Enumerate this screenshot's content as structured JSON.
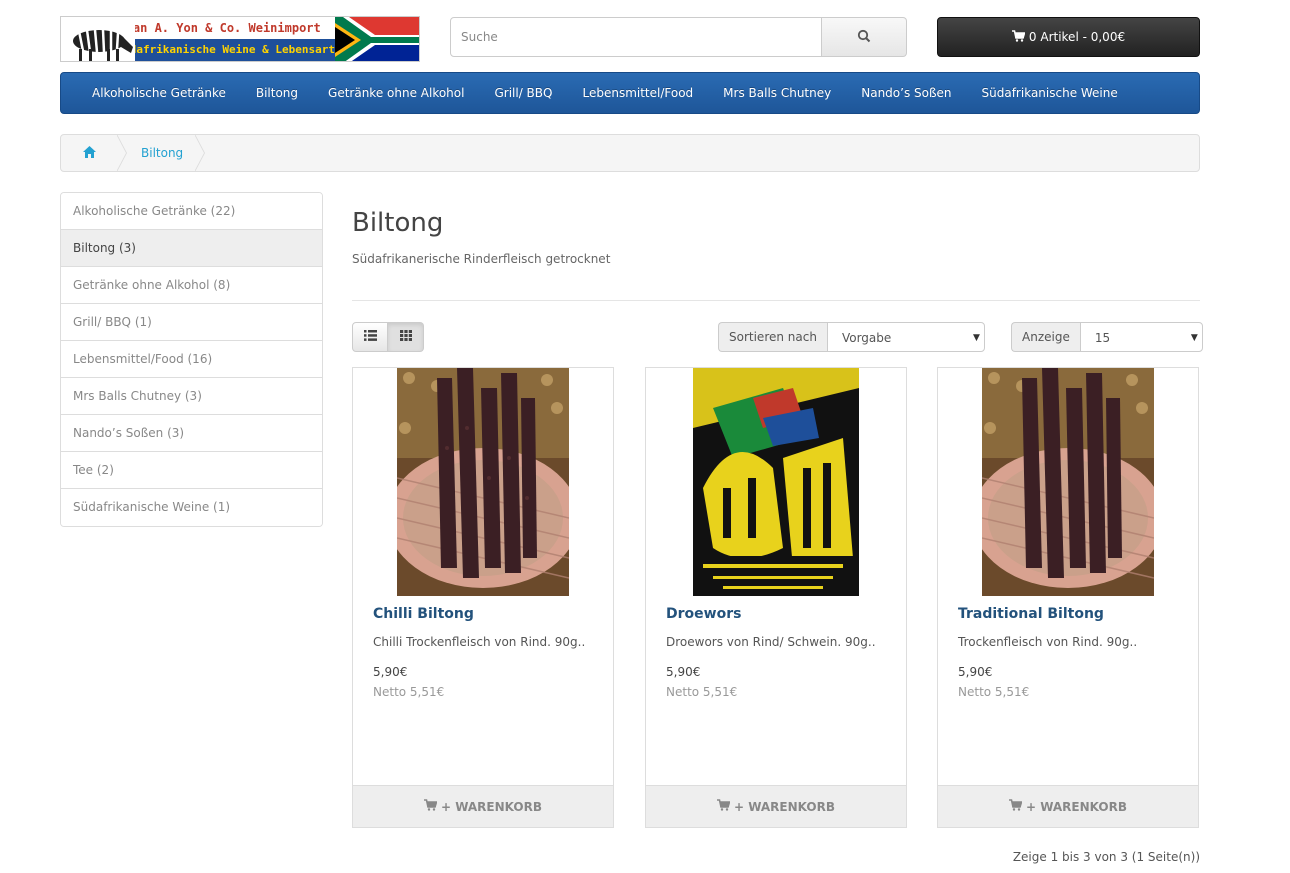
{
  "logo": {
    "line1": "Dean A. Yon & Co. Weinimport",
    "line2": "Südafrikanische Weine & Lebensart"
  },
  "search": {
    "placeholder": "Suche"
  },
  "cart": {
    "label": "0 Artikel - 0,00€"
  },
  "nav": {
    "items": [
      "Alkoholische Getränke",
      "Biltong",
      "Getränke ohne Alkohol",
      "Grill/ BBQ",
      "Lebensmittel/Food",
      "Mrs Balls Chutney",
      "Nando’s Soßen",
      "Südafrikanische Weine"
    ]
  },
  "breadcrumb": {
    "current": "Biltong"
  },
  "sidebar": {
    "categories": [
      "Alkoholische Getränke (22)",
      "Biltong (3)",
      "Getränke ohne Alkohol (8)",
      "Grill/ BBQ (1)",
      "Lebensmittel/Food (16)",
      "Mrs Balls Chutney (3)",
      "Nando’s Soßen (3)",
      "Tee (2)",
      "Südafrikanische Weine (1)"
    ],
    "active_index": 1
  },
  "page": {
    "title": "Biltong",
    "subtitle": "Südafrikanerische Rinderfleisch getrocknet"
  },
  "toolbar": {
    "sort_label": "Sortieren nach",
    "sort_value": "Vorgabe",
    "limit_label": "Anzeige",
    "limit_value": "15"
  },
  "products": [
    {
      "name": "Chilli Biltong",
      "description": "Chilli Trockenfleisch  von Rind. 90g..",
      "price": "5,90€",
      "net": "Netto 5,51€",
      "cart_label": "+ WARENKORB",
      "image": "biltong-basket"
    },
    {
      "name": "Droewors",
      "description": "Droewors  von Rind/ Schwein. 90g..",
      "price": "5,90€",
      "net": "Netto 5,51€",
      "cart_label": "+ WARENKORB",
      "image": "safari-biltong-pack"
    },
    {
      "name": "Traditional Biltong",
      "description": "Trockenfleisch  von Rind. 90g..",
      "price": "5,90€",
      "net": "Netto 5,51€",
      "cart_label": "+ WARENKORB",
      "image": "biltong-basket"
    }
  ],
  "pagination": {
    "text": "Zeige 1 bis 3 von 3 (1 Seite(n))"
  },
  "colors": {
    "nav_bg": "#1e5699",
    "link": "#23527c",
    "breadcrumb_link": "#23a1d1",
    "cart_bg": "#222222"
  },
  "icons": {
    "search": "search-icon",
    "cart": "cart-icon",
    "home": "home-icon",
    "list_view": "list-icon",
    "grid_view": "grid-icon"
  }
}
